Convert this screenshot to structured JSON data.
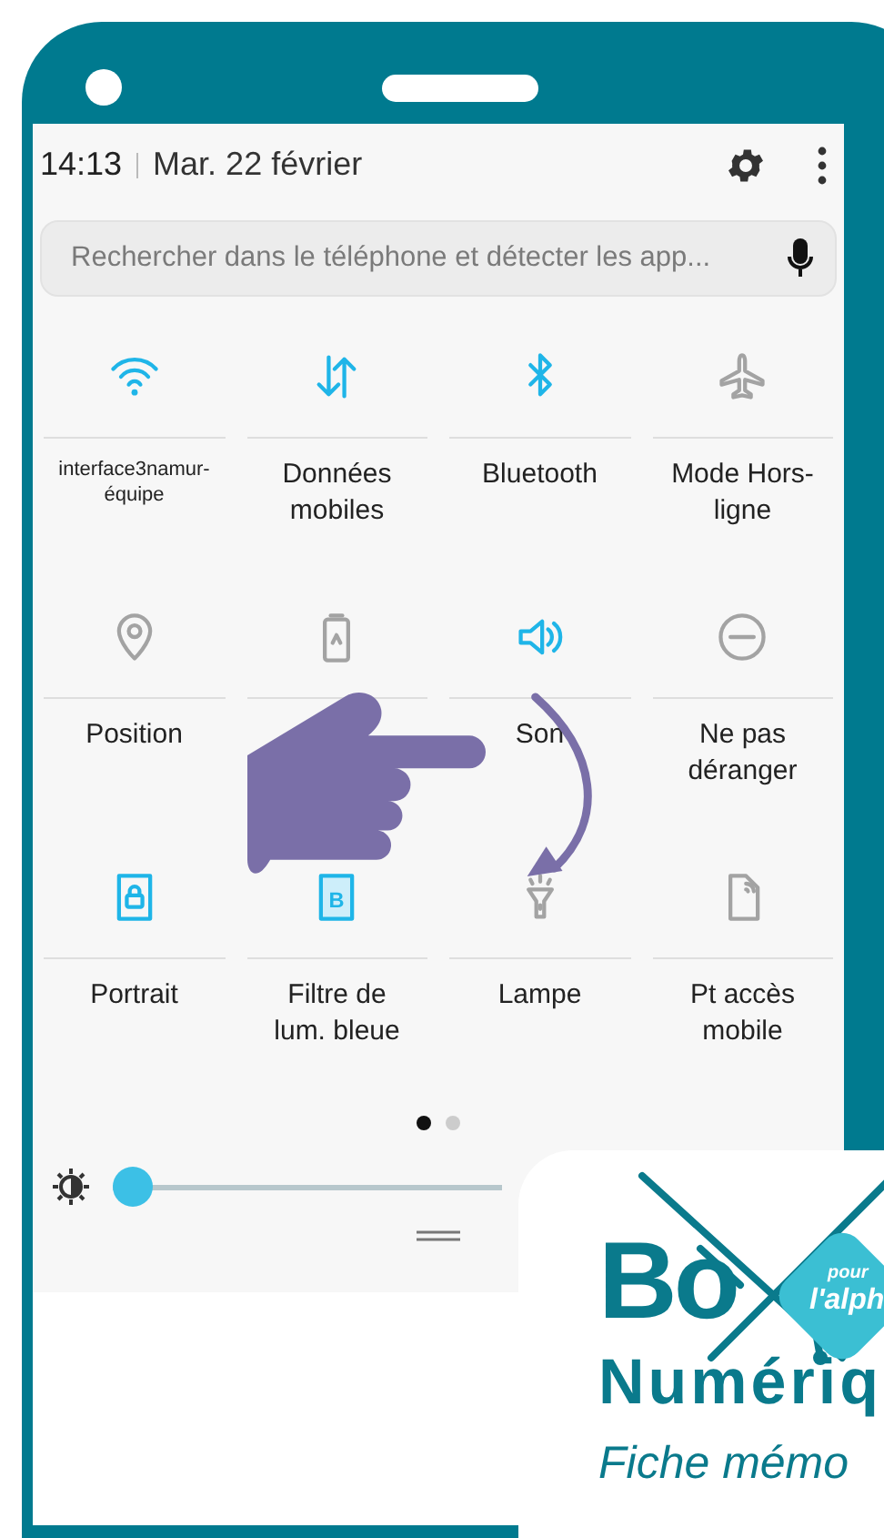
{
  "status_header": {
    "time": "14:13",
    "date": "Mar. 22 février"
  },
  "search": {
    "placeholder": "Rechercher dans le téléphone et détecter les app..."
  },
  "tiles": [
    {
      "kind": "wifi",
      "label": "interface3namur-équipe",
      "on": true
    },
    {
      "kind": "data",
      "label": "Données mobiles",
      "on": true
    },
    {
      "kind": "bluetooth",
      "label": "Bluetooth",
      "on": true
    },
    {
      "kind": "airplane",
      "label": "Mode Hors-ligne",
      "on": false
    },
    {
      "kind": "location",
      "label": "Position",
      "on": false
    },
    {
      "kind": "battery",
      "on": false
    },
    {
      "kind": "sound",
      "label": "Son",
      "on": true
    },
    {
      "kind": "dnd",
      "label": "Ne pas déranger",
      "on": false
    },
    {
      "kind": "portrait",
      "label": "Portrait",
      "on": true
    },
    {
      "kind": "bluefilter",
      "icon_letter": "B",
      "label": "Filtre de lum. bleue",
      "on": true
    },
    {
      "kind": "torch",
      "label": "Lampe",
      "on": false
    },
    {
      "kind": "hotspot",
      "label": "Pt accès mobile",
      "on": false
    }
  ],
  "pages": [
    {
      "selected": true
    },
    {
      "selected": false
    }
  ],
  "brightness": {
    "level": 0.0
  },
  "logo": {
    "title": "Bo",
    "badge_top": "pour",
    "badge_bottom": "l'alph",
    "subtitle": "Numériq",
    "caption": "Fiche mémo"
  }
}
